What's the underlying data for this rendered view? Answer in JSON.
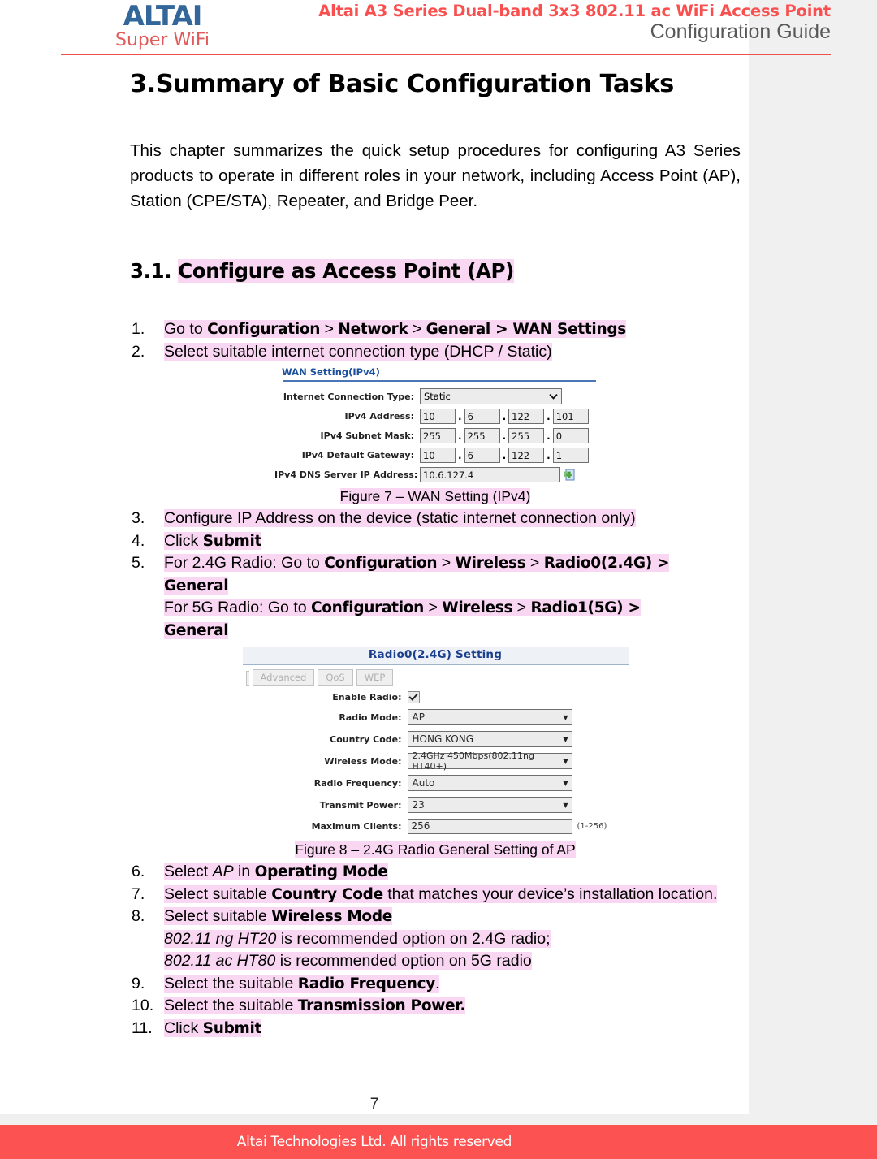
{
  "header": {
    "logo_main": "ALTAI",
    "logo_sub": "Super WiFi",
    "title": "Altai A3 Series Dual-band 3x3 802.11 ac WiFi Access Point",
    "subtitle": "Configuration Guide"
  },
  "chapter": {
    "title": "3.Summary of Basic Configuration Tasks",
    "intro": "This chapter summarizes the quick setup procedures for configuring A3 Series products to operate in different roles in your network, including Access Point (AP), Station (CPE/STA), Repeater, and Bridge Peer."
  },
  "section": {
    "number": "3.1.",
    "title": "Configure as Access Point (AP)"
  },
  "steps": {
    "n1": "1.",
    "s1_a": "Go to ",
    "s1_b1": "Configuration",
    "s1_c": " > ",
    "s1_b2": "Network",
    "s1_d": " > ",
    "s1_b3": "General > WAN Settings",
    "n2": "2.",
    "s2": "Select suitable internet connection type (DHCP / Static)",
    "n3": "3.",
    "s3": "Configure IP Address on the device (static internet connection only)",
    "n4": "4.",
    "s4_a": "Click ",
    "s4_b": "Submit",
    "n5": "5.",
    "s5_24_a": "For 2.4G Radio: Go to ",
    "s5_24_b1": "Configuration",
    "s5_24_b2": "Wireless",
    "s5_24_b3": "Radio0(2.4G) >",
    "s5_24_b4": "General",
    "s5_5g_a": "For 5G Radio: Go to ",
    "s5_5g_b1": "Configuration",
    "s5_5g_b2": "Wireless",
    "s5_5g_b3": "Radio1(5G) >",
    "s5_5g_b4": "General",
    "gt": ">",
    "n6": "6.",
    "s6_a": "Select ",
    "s6_i": "AP",
    "s6_b": " in ",
    "s6_bold": "Operating Mode",
    "n7": "7.",
    "s7_a": "Select suitable ",
    "s7_bold": "Country Code",
    "s7_b": " that matches your device’s installation location.",
    "n8": "8.",
    "s8_a": "Select suitable ",
    "s8_bold": "Wireless Mode",
    "s8_l2_i": "802.11 ng HT20",
    "s8_l2_r": " is recommended option on 2.4G radio;",
    "s8_l3_i": "802.11 ac HT80",
    "s8_l3_r": " is recommended option on 5G radio",
    "n9": "9.",
    "s9_a": "Select the suitable ",
    "s9_bold": "Radio Frequency",
    "s9_b": ".",
    "n10": "10.",
    "s10_a": "Select the suitable ",
    "s10_bold": "Transmission Power.",
    "n11": "11.",
    "s11_a": "Click ",
    "s11_bold": "Submit"
  },
  "figure7": {
    "caption": "Figure 7 – WAN Setting (IPv4)",
    "panel_title": "WAN Setting(IPv4)",
    "fields": {
      "conn_type_label": "Internet Connection Type:",
      "conn_type_value": "Static",
      "ipv4_addr_label": "IPv4 Address:",
      "ipv4_addr": [
        "10",
        "6",
        "122",
        "101"
      ],
      "subnet_label": "IPv4 Subnet Mask:",
      "subnet": [
        "255",
        "255",
        "255",
        "0"
      ],
      "gateway_label": "IPv4 Default Gateway:",
      "gateway": [
        "10",
        "6",
        "122",
        "1"
      ],
      "dns_label": "IPv4 DNS Server IP Address:",
      "dns_value": "10.6.127.4"
    },
    "separator": "."
  },
  "figure8": {
    "caption": "Figure 8 – 2.4G Radio General Setting of AP",
    "panel_title": "Radio0(2.4G) Setting",
    "tabs": [
      "Advanced",
      "QoS",
      "WEP"
    ],
    "fields": {
      "enable_radio_label": "Enable Radio:",
      "radio_mode_label": "Radio Mode:",
      "radio_mode_value": "AP",
      "country_code_label": "Country Code:",
      "country_code_value": "HONG KONG",
      "wireless_mode_label": "Wireless Mode:",
      "wireless_mode_value": "2.4GHz 450Mbps(802.11ng HT40+)",
      "radio_freq_label": "Radio Frequency:",
      "radio_freq_value": "Auto",
      "transmit_power_label": "Transmit Power:",
      "transmit_power_value": "23",
      "max_clients_label": "Maximum Clients:",
      "max_clients_value": "256",
      "max_clients_hint": "(1-256)"
    },
    "dropdown_arrow": "▼"
  },
  "footer": {
    "page_number": "7",
    "copyright": "Altai Technologies Ltd. All rights reserved"
  },
  "colors": {
    "brand_red": "#f9504f",
    "footer_red": "#fd5252",
    "logo_blue": "#336699",
    "highlight_pink": "#f9d6f2",
    "panel_blue": "#1a4f9c"
  }
}
